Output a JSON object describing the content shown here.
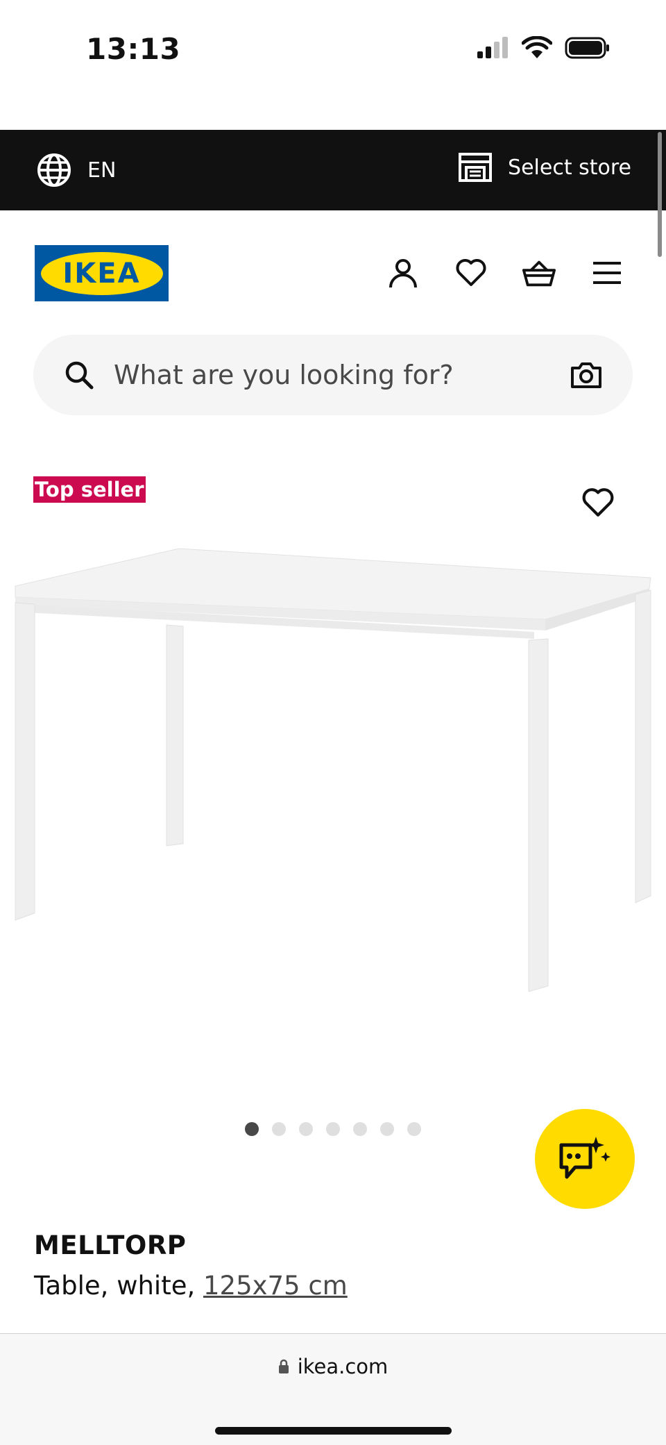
{
  "status_bar": {
    "time": "13:13"
  },
  "top_bar": {
    "language": "EN",
    "store_label": "Select store"
  },
  "header": {
    "logo_text": "IKEA",
    "icons": [
      "profile-icon",
      "heart-icon",
      "basket-icon",
      "menu-icon"
    ]
  },
  "search": {
    "placeholder": "What are you looking for?"
  },
  "product": {
    "badge": "Top seller",
    "name": "MELLTORP",
    "description_prefix": "Table, white, ",
    "size": "125x75 cm",
    "image_count": 7,
    "active_image": 1
  },
  "browser": {
    "url": "ikea.com"
  },
  "colors": {
    "ikea_blue": "#0058a3",
    "ikea_yellow": "#ffdb00",
    "badge_red": "#cc0a4f",
    "top_bar_bg": "#111111"
  }
}
